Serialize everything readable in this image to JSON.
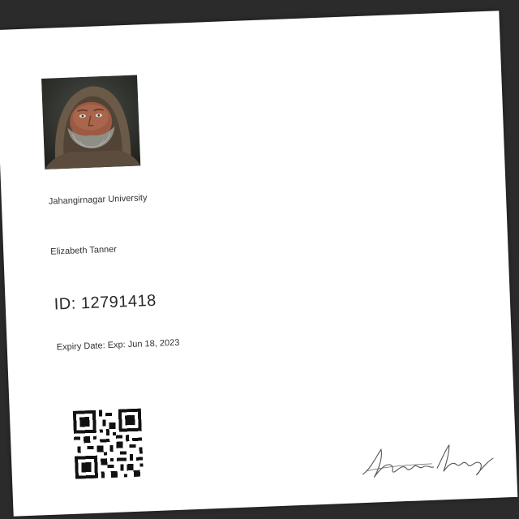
{
  "card": {
    "university": "Jahangirnagar University",
    "holder_name": "Elizabeth Tanner",
    "id_label": "ID:",
    "id_number": "12791418",
    "expiry_label": "Expiry Date:",
    "expiry_value": "Exp: Jun 18, 2023"
  },
  "icons": {
    "photo": "portrait-photo",
    "qr": "qr-code-icon",
    "signature": "signature"
  }
}
